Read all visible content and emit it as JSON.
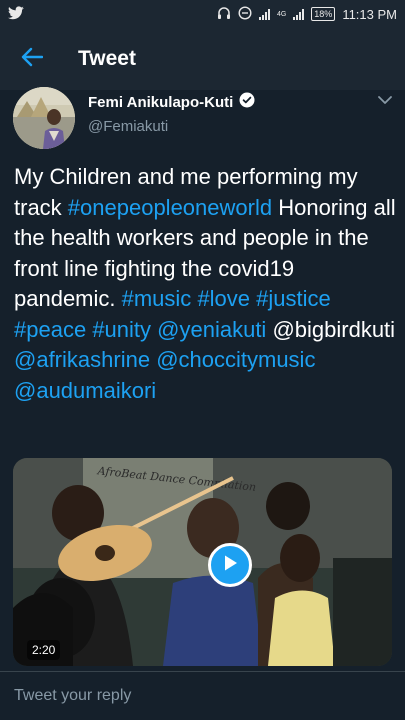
{
  "status_bar": {
    "network_label": "4G",
    "battery_label": "18%",
    "time": "11:13 PM"
  },
  "header": {
    "title": "Tweet"
  },
  "tweet": {
    "author_name": "Femi Anikulapo-Kuti",
    "author_handle": "@Femiakuti",
    "text": [
      {
        "t": "My Children and me performing my track  ",
        "link": false
      },
      {
        "t": "#onepeopleoneworld",
        "link": true
      },
      {
        "t": " Honoring all the health workers and people in the front line fighting the covid19 pandemic. ",
        "link": false
      },
      {
        "t": "#music",
        "link": true
      },
      {
        "t": " ",
        "link": false
      },
      {
        "t": "#love",
        "link": true
      },
      {
        "t": " ",
        "link": false
      },
      {
        "t": "#justice",
        "link": true
      },
      {
        "t": " ",
        "link": false
      },
      {
        "t": "#peace",
        "link": true
      },
      {
        "t": " ",
        "link": false
      },
      {
        "t": "#unity",
        "link": true
      },
      {
        "t": " ",
        "link": false
      },
      {
        "t": "@yeniakuti",
        "link": true
      },
      {
        "t": " @bigbirdkuti ",
        "link": false
      },
      {
        "t": "@afrikashrine",
        "link": true
      },
      {
        "t": " ",
        "link": false
      },
      {
        "t": "@choccitymusic",
        "link": true
      },
      {
        "t": " ",
        "link": false
      },
      {
        "t": "@audumaikori",
        "link": true
      }
    ],
    "video": {
      "duration": "2:20",
      "sign_text": "AfroBeat Dance Compilation"
    }
  },
  "reply": {
    "placeholder": "Tweet your reply"
  },
  "colors": {
    "background": "#15202b",
    "header_background": "#1c2732",
    "accent": "#1da1f2",
    "secondary_text": "#8899a6"
  },
  "icons": {
    "status_left": "twitter-bird-icon",
    "status_right": [
      "headset-icon",
      "do-not-disturb-icon",
      "signal-icon",
      "signal-icon",
      "battery-icon"
    ],
    "back": "arrow-left-icon",
    "verified": "verified-badge-icon",
    "menu": "chevron-down-icon",
    "play": "play-icon"
  }
}
